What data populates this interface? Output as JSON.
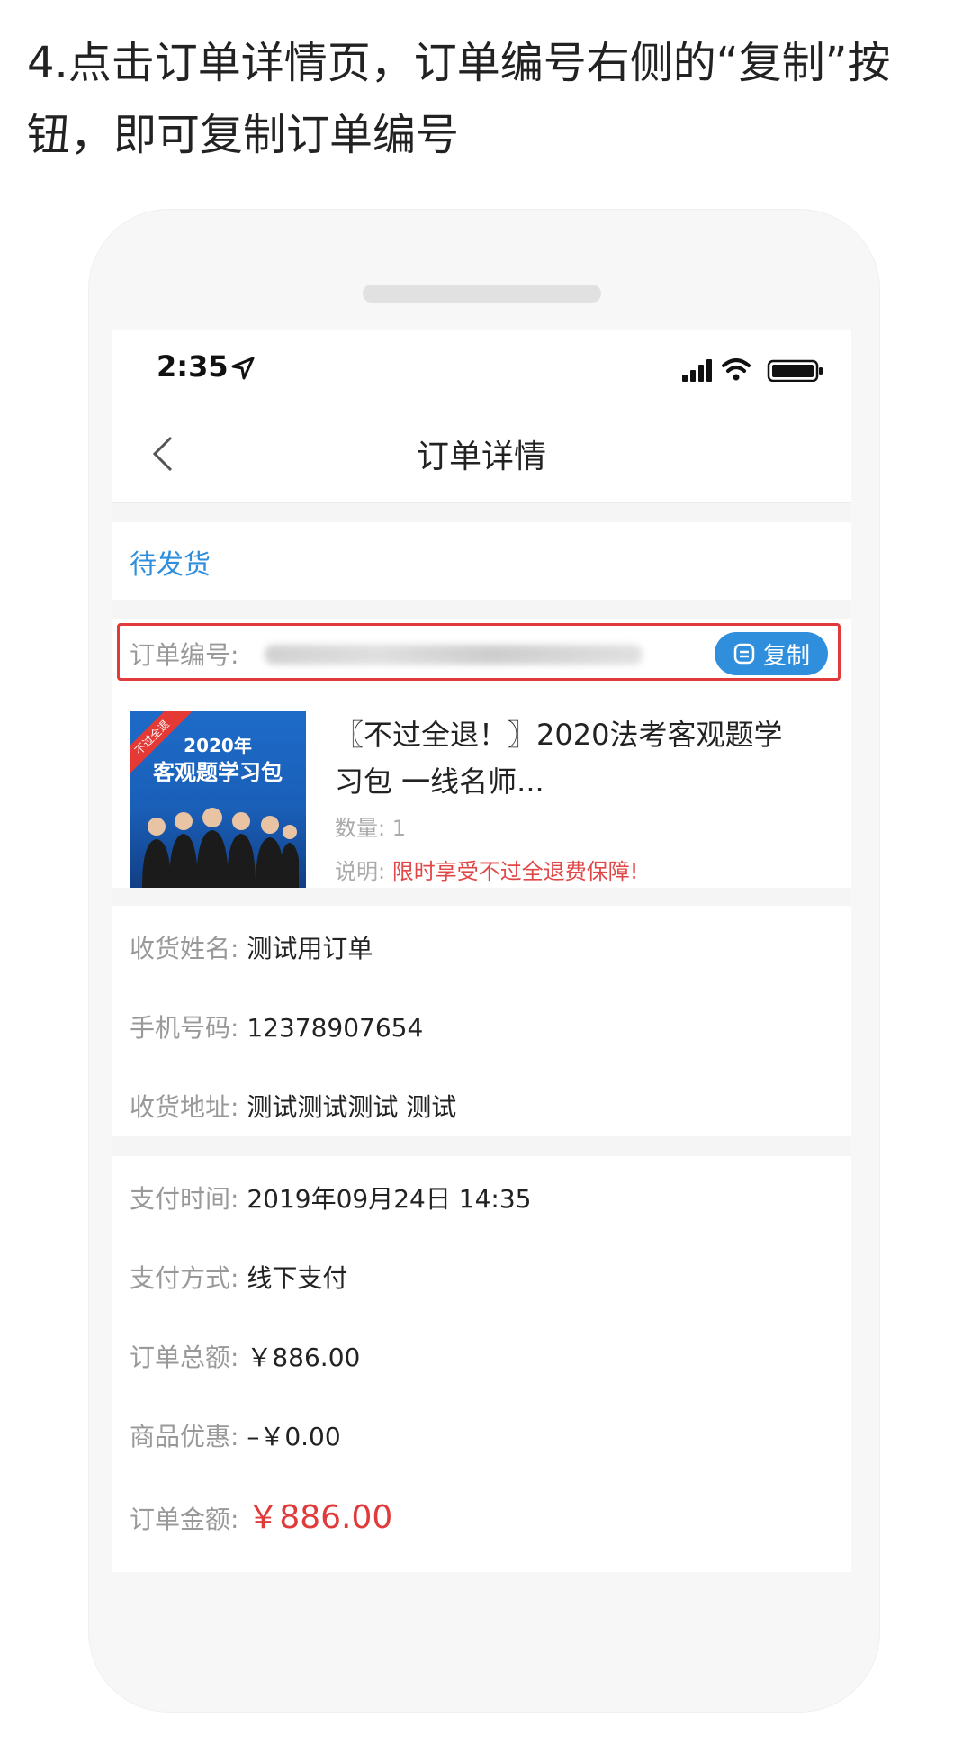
{
  "instruction": "4.点击订单详情页，订单编号右侧的“复制”按钮，即可复制订单编号",
  "status_bar": {
    "time": "2:35"
  },
  "nav": {
    "title": "订单详情"
  },
  "order_status": "待发货",
  "order_number": {
    "label": "订单编号:",
    "copy_label": "复制"
  },
  "product": {
    "thumb_year": "2020年",
    "thumb_title": "客观题学习包",
    "thumb_ribbon": "不过全退",
    "name": "〖不过全退！〗2020法考客观题学习包  一线名师...",
    "qty_label": "数量:",
    "qty_value": "1",
    "note_label": "说明:",
    "note_value": "限时享受不过全退费保障!"
  },
  "receiver": {
    "rows": [
      {
        "label": "收货姓名:",
        "value": "测试用订单"
      },
      {
        "label": "手机号码:",
        "value": "12378907654"
      },
      {
        "label": "收货地址:",
        "value": "测试测试测试 测试"
      }
    ]
  },
  "payment": {
    "rows": [
      {
        "label": "支付时间:",
        "value": "2019年09月24日 14:35"
      },
      {
        "label": "支付方式:",
        "value": "线下支付"
      },
      {
        "label": "订单总额:",
        "value": "￥886.00"
      },
      {
        "label": "商品优惠:",
        "value": "–￥0.00"
      },
      {
        "label": "订单金额:",
        "value": "￥886.00"
      }
    ]
  },
  "colors": {
    "accent": "#2f8fdc",
    "highlight": "#e03a3a",
    "price": "#e03a3a"
  }
}
